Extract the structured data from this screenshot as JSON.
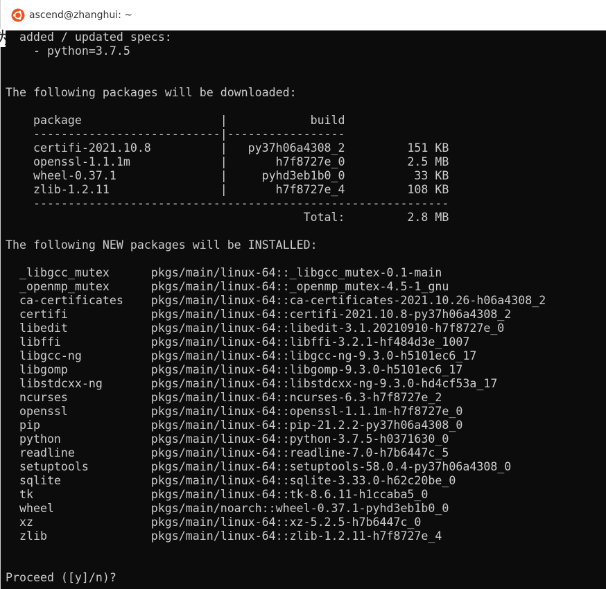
{
  "window": {
    "title": "ascend@zhanghui: ~",
    "app_icon": "ubuntu-icon",
    "colors": {
      "background": "#0c0c0c",
      "text": "#cccccc",
      "titlebar": "#ffffff",
      "accent": "#e95420"
    }
  },
  "terminal": {
    "lines": [
      "  added / updated specs:",
      "    - python=3.7.5",
      "",
      "",
      "The following packages will be downloaded:",
      "",
      "    package                    |            build",
      "    ---------------------------|-----------------",
      "    certifi-2021.10.8          |   py37h06a4308_2         151 KB",
      "    openssl-1.1.1m             |       h7f8727e_0         2.5 MB",
      "    wheel-0.37.1               |     pyhd3eb1b0_0          33 KB",
      "    zlib-1.2.11                |       h7f8727e_4         108 KB",
      "    ------------------------------------------------------------",
      "                                           Total:         2.8 MB",
      "",
      "The following NEW packages will be INSTALLED:",
      "",
      "  _libgcc_mutex      pkgs/main/linux-64::_libgcc_mutex-0.1-main",
      "  _openmp_mutex      pkgs/main/linux-64::_openmp_mutex-4.5-1_gnu",
      "  ca-certificates    pkgs/main/linux-64::ca-certificates-2021.10.26-h06a4308_2",
      "  certifi            pkgs/main/linux-64::certifi-2021.10.8-py37h06a4308_2",
      "  libedit            pkgs/main/linux-64::libedit-3.1.20210910-h7f8727e_0",
      "  libffi             pkgs/main/linux-64::libffi-3.2.1-hf484d3e_1007",
      "  libgcc-ng          pkgs/main/linux-64::libgcc-ng-9.3.0-h5101ec6_17",
      "  libgomp            pkgs/main/linux-64::libgomp-9.3.0-h5101ec6_17",
      "  libstdcxx-ng       pkgs/main/linux-64::libstdcxx-ng-9.3.0-hd4cf53a_17",
      "  ncurses            pkgs/main/linux-64::ncurses-6.3-h7f8727e_2",
      "  openssl            pkgs/main/linux-64::openssl-1.1.1m-h7f8727e_0",
      "  pip                pkgs/main/linux-64::pip-21.2.2-py37h06a4308_0",
      "  python             pkgs/main/linux-64::python-3.7.5-h0371630_0",
      "  readline           pkgs/main/linux-64::readline-7.0-h7b6447c_5",
      "  setuptools         pkgs/main/linux-64::setuptools-58.0.4-py37h06a4308_0",
      "  sqlite             pkgs/main/linux-64::sqlite-3.33.0-h62c20be_0",
      "  tk                 pkgs/main/linux-64::tk-8.6.11-h1ccaba5_0",
      "  wheel              pkgs/main/noarch::wheel-0.37.1-pyhd3eb1b0_0",
      "  xz                 pkgs/main/linux-64::xz-5.2.5-h7b6447c_0",
      "  zlib               pkgs/main/linux-64::zlib-1.2.11-h7f8727e_4",
      "",
      "",
      "Proceed ([y]/n)?"
    ]
  }
}
